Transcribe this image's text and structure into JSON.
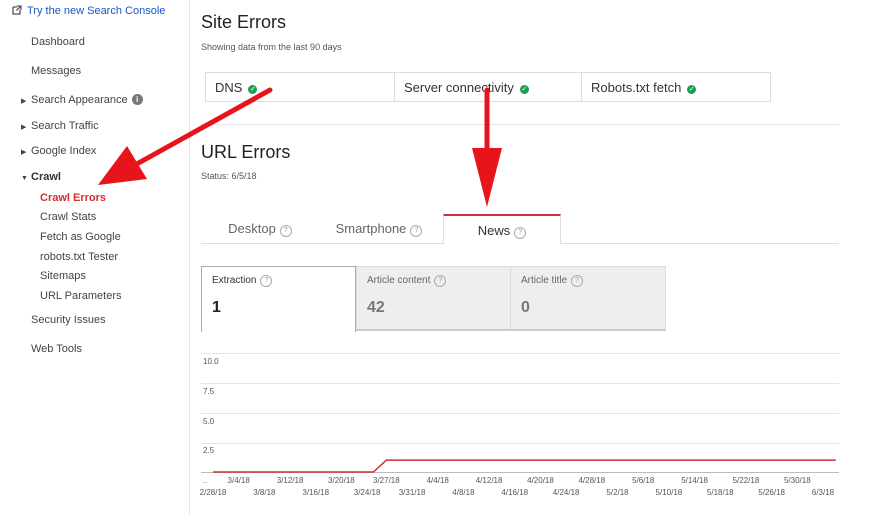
{
  "sidebar": {
    "try_link": "Try the new Search Console",
    "items": [
      {
        "label": "Dashboard"
      },
      {
        "label": "Messages"
      },
      {
        "label": "Search Appearance"
      },
      {
        "label": "Search Traffic"
      },
      {
        "label": "Google Index"
      },
      {
        "label": "Crawl"
      },
      {
        "label": "Security Issues"
      },
      {
        "label": "Web Tools"
      }
    ],
    "crawl_sub": [
      {
        "label": "Crawl Errors"
      },
      {
        "label": "Crawl Stats"
      },
      {
        "label": "Fetch as Google"
      },
      {
        "label": "robots.txt Tester"
      },
      {
        "label": "Sitemaps"
      },
      {
        "label": "URL Parameters"
      }
    ],
    "info_glyph": "i"
  },
  "site_errors": {
    "title": "Site Errors",
    "subtitle": "Showing data from the last 90 days",
    "boxes": [
      {
        "label": "DNS",
        "status": "ok"
      },
      {
        "label": "Server connectivity",
        "status": "ok"
      },
      {
        "label": "Robots.txt fetch",
        "status": "ok"
      }
    ],
    "check_glyph": "✓"
  },
  "url_errors": {
    "title": "URL Errors",
    "status": "Status: 6/5/18",
    "tabs": [
      {
        "label": "Desktop"
      },
      {
        "label": "Smartphone"
      },
      {
        "label": "News"
      }
    ],
    "active_tab": "News",
    "help_glyph": "?",
    "metrics": [
      {
        "label": "Extraction",
        "value": "1"
      },
      {
        "label": "Article content",
        "value": "42"
      },
      {
        "label": "Article title",
        "value": "0"
      }
    ]
  },
  "colors": {
    "accent": "#d32f2f",
    "ok": "#1e9e55",
    "link": "#1a0dab"
  },
  "chart_data": {
    "type": "line",
    "y_ticks": [
      "2.5",
      "5.0",
      "7.5",
      "10.0"
    ],
    "ylim": [
      0,
      10
    ],
    "x_start_label": "..",
    "x_ticks_upper": [
      "3/4/18",
      "3/12/18",
      "3/20/18",
      "3/27/18",
      "4/4/18",
      "4/12/18",
      "4/20/18",
      "4/28/18",
      "5/6/18",
      "5/14/18",
      "5/22/18",
      "5/30/18"
    ],
    "x_ticks_lower": [
      "2/28/18",
      "3/8/18",
      "3/16/18",
      "3/24/18",
      "3/31/18",
      "4/8/18",
      "4/16/18",
      "4/24/18",
      "5/2/18",
      "5/10/18",
      "5/18/18",
      "5/26/18",
      "6/3/18"
    ],
    "series": [
      {
        "color": "#d32f2f",
        "points": [
          {
            "x": "2/28/18",
            "y": 0
          },
          {
            "x": "3/25/18",
            "y": 0
          },
          {
            "x": "3/27/18",
            "y": 1
          },
          {
            "x": "6/5/18",
            "y": 1
          }
        ]
      }
    ]
  },
  "annotations": {
    "arrow_color": "#e8141b"
  }
}
